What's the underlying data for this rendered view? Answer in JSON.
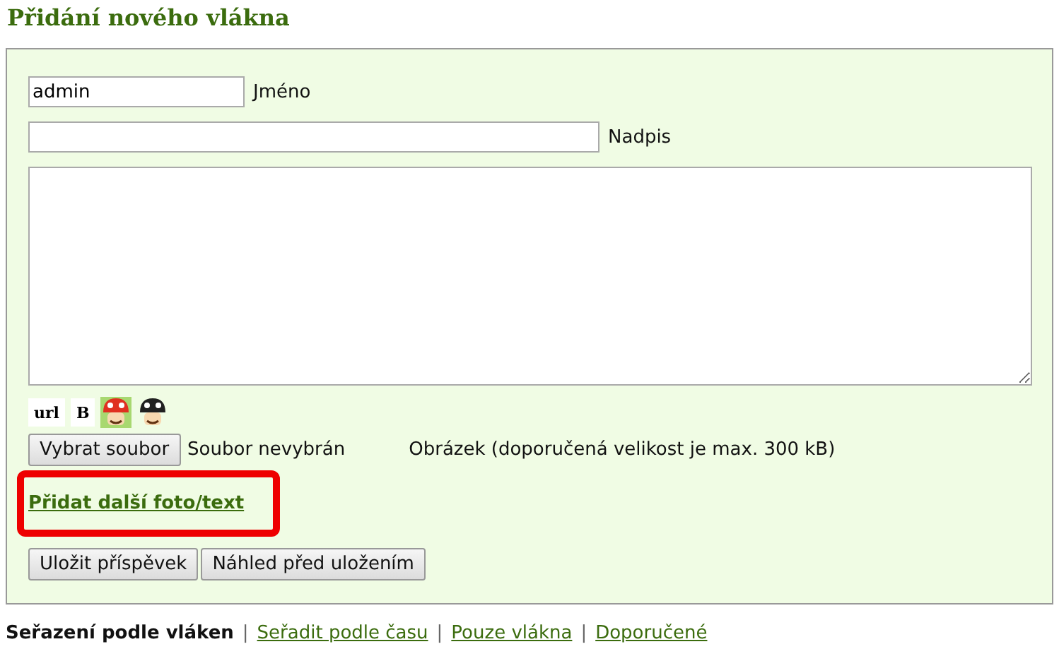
{
  "heading": "Přidání nového vlákna",
  "form": {
    "name_field": {
      "value": "admin",
      "label": "Jméno"
    },
    "title_field": {
      "label": "Nadpis"
    },
    "toolbar": [
      {
        "kind": "text",
        "label": "url"
      },
      {
        "kind": "text",
        "label": "B"
      },
      {
        "kind": "smiley",
        "color": "#e03020"
      },
      {
        "kind": "smiley",
        "color": "#202020"
      }
    ],
    "file": {
      "button": "Vybrat soubor",
      "status": "Soubor nevybrán",
      "hint": "Obrázek (doporučená velikost je max. 300 kB)"
    },
    "add_link": {
      "label": "Přidat další foto/text",
      "highlighted": true
    },
    "buttons": [
      "Uložit příspěvek",
      "Náhled před uložením"
    ]
  },
  "sort_options": [
    {
      "label": "Seřazení podle vláken",
      "selected": true
    },
    {
      "label": "Seřadit podle času",
      "selected": false,
      "sep": "|"
    },
    {
      "label": "Pouze vlákna",
      "selected": false,
      "sep": "|"
    },
    {
      "label": "Doporučené",
      "selected": false,
      "sep": "|"
    }
  ]
}
